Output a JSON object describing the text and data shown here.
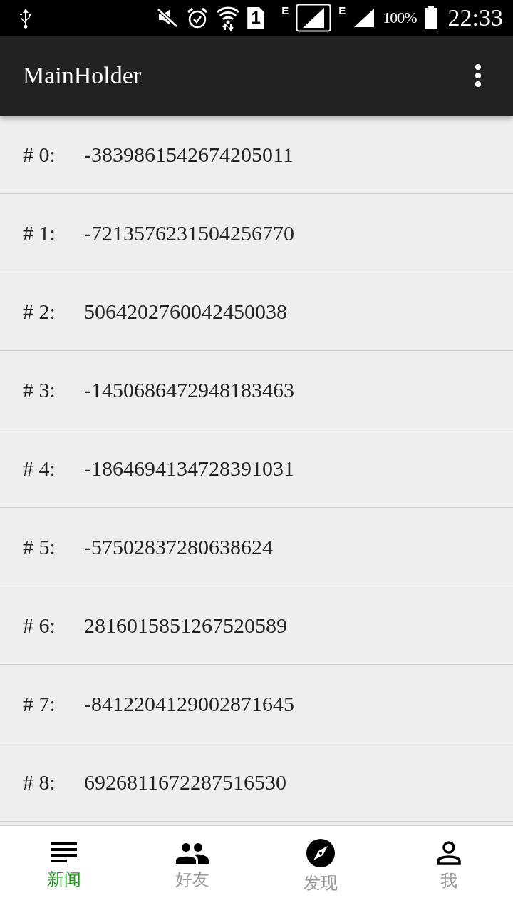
{
  "status_bar": {
    "sim_slot": "1",
    "network_1": "E",
    "network_2": "E",
    "battery": "100%",
    "time": "22:33"
  },
  "app_bar": {
    "title": "MainHolder"
  },
  "list": [
    {
      "index": "# 0:",
      "value": "-3839861542674205011"
    },
    {
      "index": "# 1:",
      "value": "-7213576231504256770"
    },
    {
      "index": "# 2:",
      "value": "5064202760042450038"
    },
    {
      "index": "# 3:",
      "value": "-1450686472948183463"
    },
    {
      "index": "# 4:",
      "value": "-1864694134728391031"
    },
    {
      "index": "# 5:",
      "value": "-57502837280638624"
    },
    {
      "index": "# 6:",
      "value": "2816015851267520589"
    },
    {
      "index": "# 7:",
      "value": "-8412204129002871645"
    },
    {
      "index": "# 8:",
      "value": "6926811672287516530"
    }
  ],
  "bottom_nav": [
    {
      "kind": "news",
      "label": "新闻",
      "selected": true
    },
    {
      "kind": "friends",
      "label": "好友",
      "selected": false
    },
    {
      "kind": "discover",
      "label": "发现",
      "selected": false
    },
    {
      "kind": "me",
      "label": "我",
      "selected": false
    }
  ]
}
